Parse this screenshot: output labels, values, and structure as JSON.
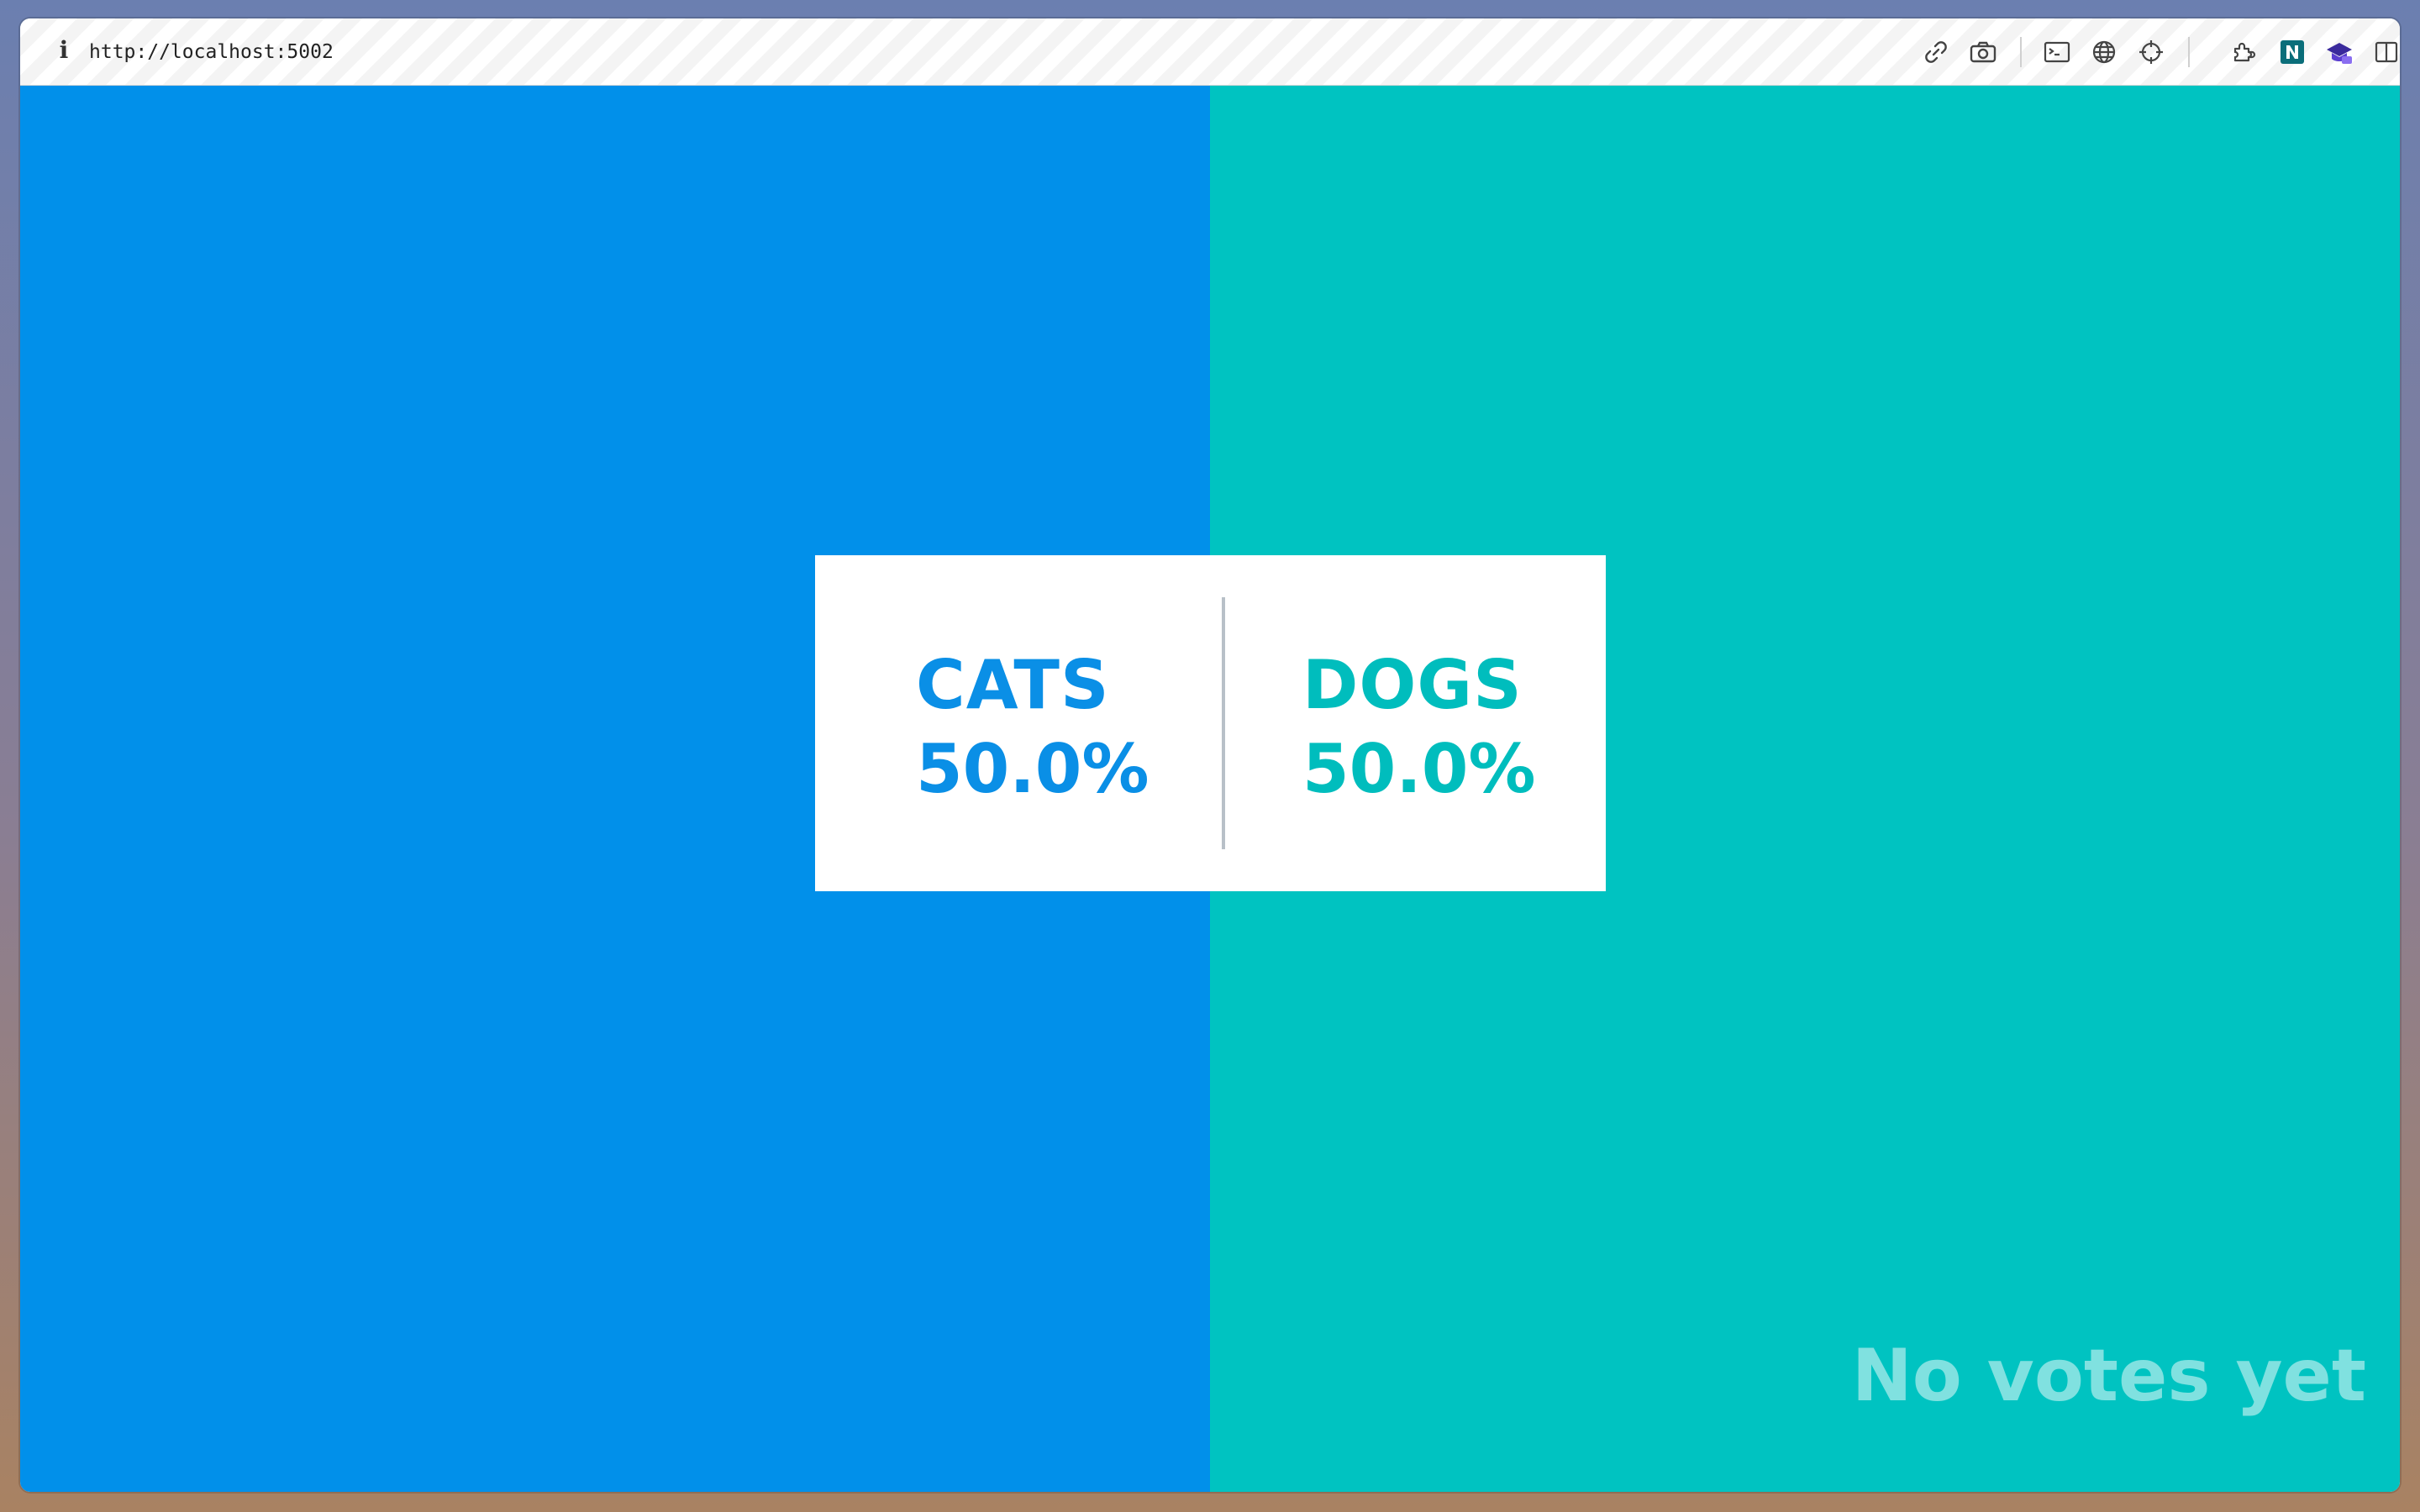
{
  "browser": {
    "url": "http://localhost:5002",
    "info_icon": "i",
    "toolbar_icons": [
      "link-icon",
      "camera-icon",
      "terminal-icon",
      "globe-icon",
      "crosshair-icon",
      "extensions-icon",
      "n-extension-icon",
      "graduation-cap-icon",
      "sidebar-toggle-icon"
    ]
  },
  "colors": {
    "cats": "#0190ea",
    "dogs": "#00c3c1"
  },
  "results": {
    "cats": {
      "label": "CATS",
      "percent": "50.0%"
    },
    "dogs": {
      "label": "DOGS",
      "percent": "50.0%"
    }
  },
  "status": {
    "text": "No votes yet"
  }
}
